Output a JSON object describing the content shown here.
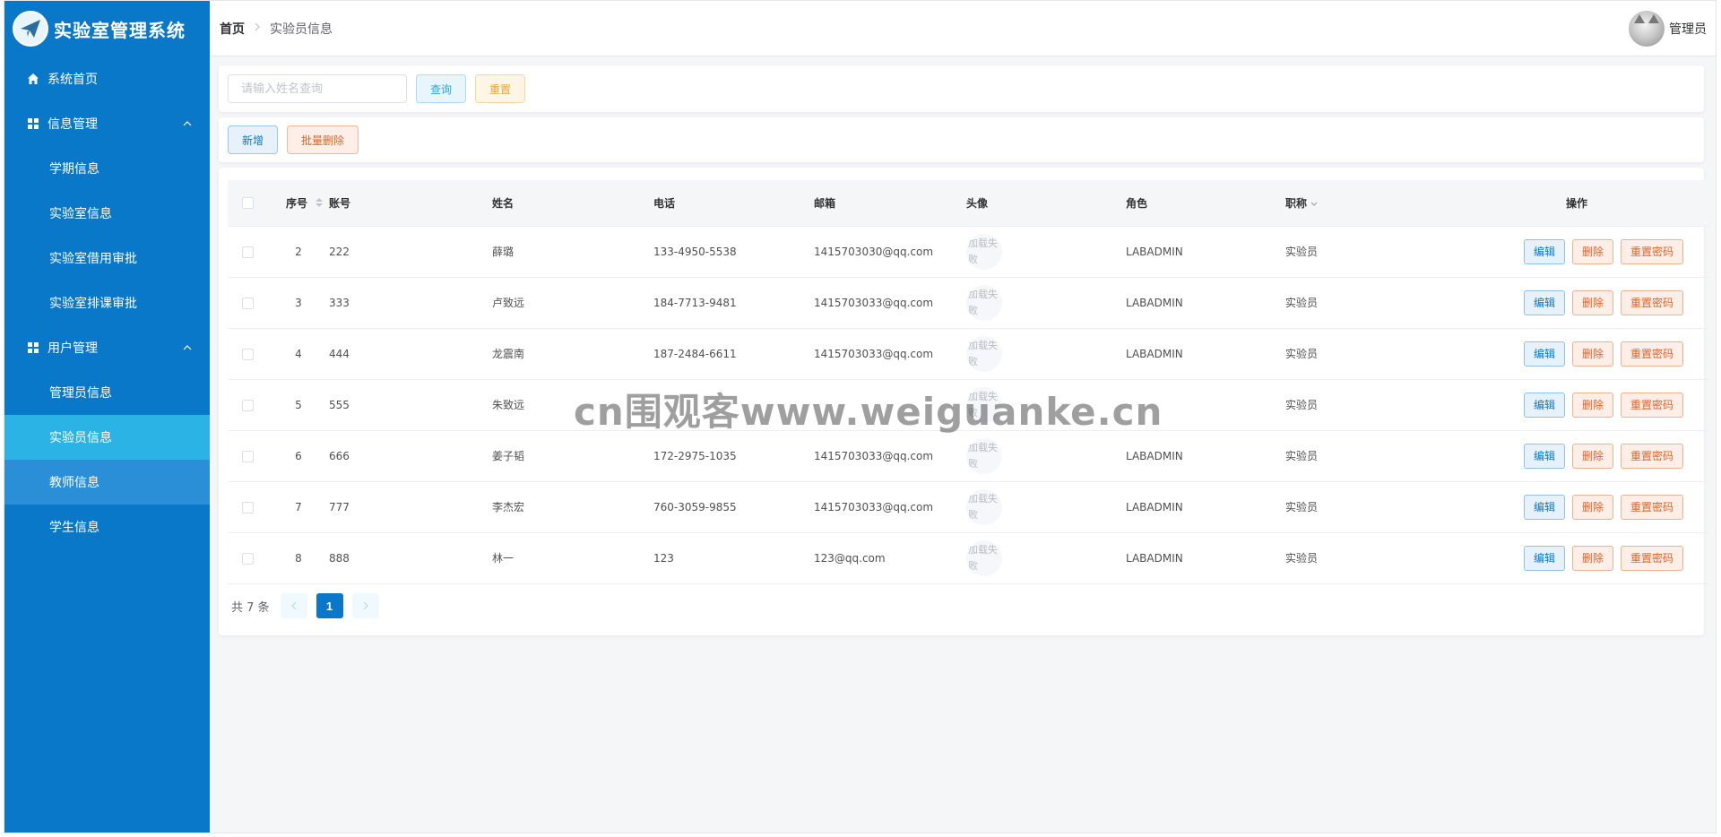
{
  "app": {
    "title": "实验室管理系统"
  },
  "colors": {
    "sidebar": "#0a78c8",
    "active_item": "#2cb3e6",
    "hovered_item": "#2a8fd6",
    "accent": "#0a78c8"
  },
  "sidebar": {
    "items": [
      {
        "label": "系统首页",
        "icon": "home-icon",
        "level": "top"
      },
      {
        "label": "信息管理",
        "icon": "grid-icon",
        "level": "top",
        "expanded": true
      },
      {
        "label": "学期信息",
        "level": "sub"
      },
      {
        "label": "实验室信息",
        "level": "sub"
      },
      {
        "label": "实验室借用审批",
        "level": "sub"
      },
      {
        "label": "实验室排课审批",
        "level": "sub"
      },
      {
        "label": "用户管理",
        "icon": "grid-icon",
        "level": "top",
        "expanded": true
      },
      {
        "label": "管理员信息",
        "level": "sub"
      },
      {
        "label": "实验员信息",
        "level": "sub",
        "state": "active"
      },
      {
        "label": "教师信息",
        "level": "sub",
        "state": "hovered"
      },
      {
        "label": "学生信息",
        "level": "sub"
      }
    ]
  },
  "header": {
    "breadcrumb": {
      "home": "首页",
      "current": "实验员信息"
    },
    "user_name": "管理员"
  },
  "search": {
    "placeholder": "请输入姓名查询",
    "value": "",
    "query_label": "查询",
    "reset_label": "重置"
  },
  "toolbar": {
    "add_label": "新增",
    "batch_delete_label": "批量删除"
  },
  "table": {
    "columns": [
      "序号",
      "账号",
      "姓名",
      "电话",
      "邮箱",
      "头像",
      "角色",
      "职称",
      "操作"
    ],
    "avatar_fail_text": "加载失败",
    "actions": {
      "edit": "编辑",
      "delete": "删除",
      "reset_pwd": "重置密码"
    },
    "rows": [
      {
        "id": "2",
        "account": "222",
        "name": "薛璐",
        "phone": "133-4950-5538",
        "email": "1415703030@qq.com",
        "role": "LABADMIN",
        "title": "实验员"
      },
      {
        "id": "3",
        "account": "333",
        "name": "卢致远",
        "phone": "184-7713-9481",
        "email": "1415703033@qq.com",
        "role": "LABADMIN",
        "title": "实验员"
      },
      {
        "id": "4",
        "account": "444",
        "name": "龙震南",
        "phone": "187-2484-6611",
        "email": "1415703033@qq.com",
        "role": "LABADMIN",
        "title": "实验员"
      },
      {
        "id": "5",
        "account": "555",
        "name": "朱致远",
        "phone": "",
        "email": "",
        "role": "",
        "title": "实验员"
      },
      {
        "id": "6",
        "account": "666",
        "name": "姜子韬",
        "phone": "172-2975-1035",
        "email": "1415703033@qq.com",
        "role": "LABADMIN",
        "title": "实验员"
      },
      {
        "id": "7",
        "account": "777",
        "name": "李杰宏",
        "phone": "760-3059-9855",
        "email": "1415703033@qq.com",
        "role": "LABADMIN",
        "title": "实验员"
      },
      {
        "id": "8",
        "account": "888",
        "name": "林一",
        "phone": "123",
        "email": "123@qq.com",
        "role": "LABADMIN",
        "title": "实验员"
      }
    ]
  },
  "pagination": {
    "total_text": "共 7 条",
    "current_page": "1"
  },
  "watermark": "cn围观客www.weiguanke.cn"
}
